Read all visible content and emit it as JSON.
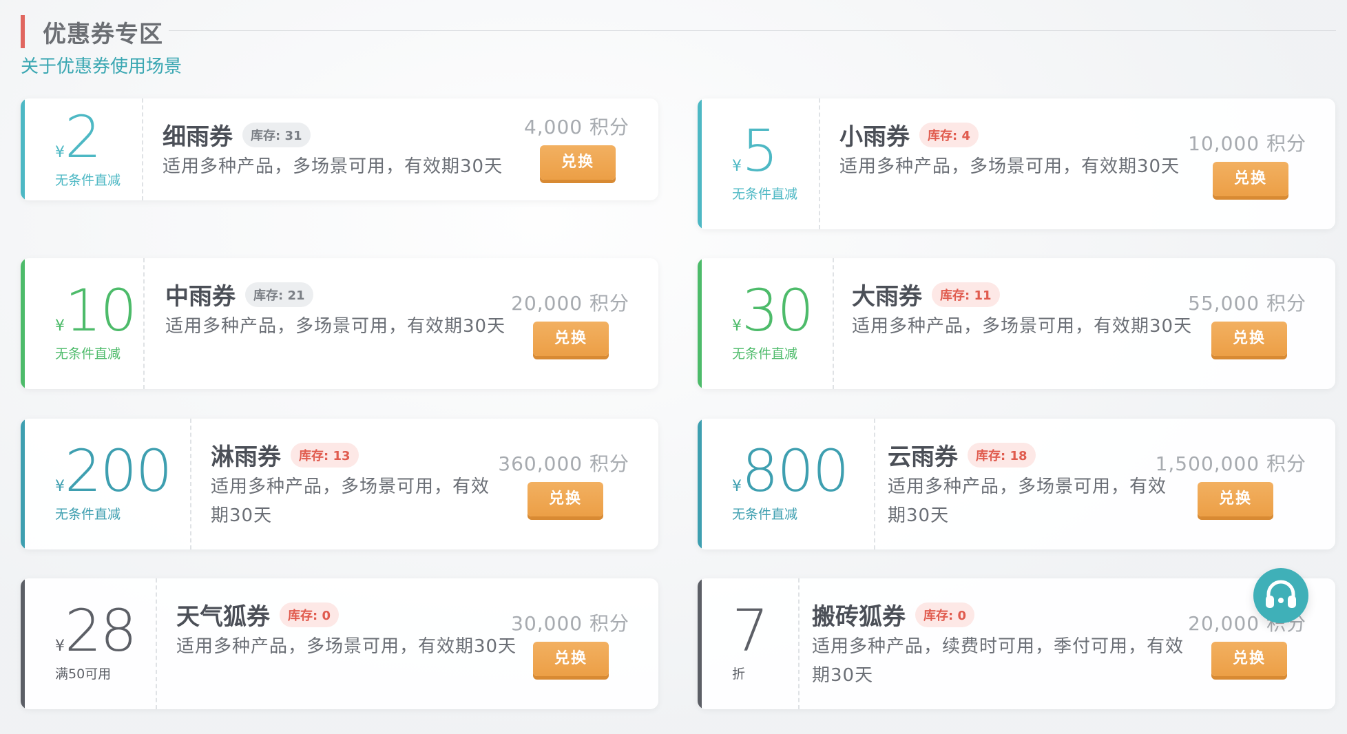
{
  "header": {
    "title": "优惠券专区",
    "subtitle": "关于优惠券使用场景"
  },
  "coupons": [
    {
      "value": "2",
      "currency": "¥",
      "condition": "无条件直减",
      "name": "细雨券",
      "stock": "库存: 31",
      "desc": "适用多种产品，多场景可用，有效期30天",
      "points": "4,000 积分",
      "button": "兑换",
      "accent_color": "#4db8c4"
    },
    {
      "value": "5",
      "currency": "¥",
      "condition": "无条件直减",
      "name": "小雨券",
      "stock": "库存: 4",
      "desc": "适用多种产品，多场景可用，有效期30天",
      "points": "10,000 积分",
      "button": "兑换",
      "accent_color": "#4db8c4"
    },
    {
      "value": "10",
      "currency": "¥",
      "condition": "无条件直减",
      "name": "中雨券",
      "stock": "库存: 21",
      "desc": "适用多种产品，多场景可用，有效期30天",
      "points": "20,000 积分",
      "button": "兑换",
      "accent_color": "#4dbb6a"
    },
    {
      "value": "30",
      "currency": "¥",
      "condition": "无条件直减",
      "name": "大雨券",
      "stock": "库存: 11",
      "desc": "适用多种产品，多场景可用，有效期30天",
      "points": "55,000 积分",
      "button": "兑换",
      "accent_color": "#4dbb6a"
    },
    {
      "value": "200",
      "currency": "¥",
      "condition": "无条件直减",
      "name": "淋雨券",
      "stock": "库存: 13",
      "desc": "适用多种产品，多场景可用，有效期30天",
      "points": "360,000 积分",
      "button": "兑换",
      "accent_color": "#3e9fb0"
    },
    {
      "value": "800",
      "currency": "¥",
      "condition": "无条件直减",
      "name": "云雨券",
      "stock": "库存: 18",
      "desc": "适用多种产品，多场景可用，有效期30天",
      "points": "1,500,000 积分",
      "button": "兑换",
      "accent_color": "#3e9fb0"
    },
    {
      "value": "28",
      "currency": "¥",
      "condition": "满50可用",
      "name": "天气狐券",
      "stock": "库存: 0",
      "desc": "适用多种产品，多场景可用，有效期30天",
      "points": "30,000 积分",
      "button": "兑换",
      "accent_color": "#5c5f66"
    },
    {
      "value": "7",
      "currency": "",
      "condition": "折",
      "name": "搬砖狐券",
      "stock": "库存: 0",
      "desc": "适用多种产品，续费时可用，季付可用，有效期30天",
      "points": "20,000 积分",
      "button": "兑换",
      "accent_color": "#5c5f66"
    }
  ],
  "support_button": {
    "icon": "headset-icon"
  }
}
